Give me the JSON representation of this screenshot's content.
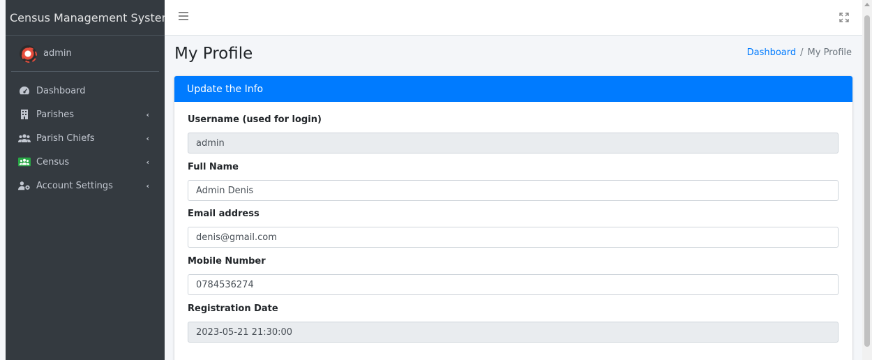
{
  "app": {
    "brand": "Census Management System"
  },
  "user": {
    "name": "admin"
  },
  "sidebar": {
    "items": [
      {
        "label": "Dashboard",
        "icon": "tachometer-icon",
        "has_arrow": false
      },
      {
        "label": "Parishes",
        "icon": "building-icon",
        "has_arrow": true
      },
      {
        "label": "Parish Chiefs",
        "icon": "users-icon",
        "has_arrow": true
      },
      {
        "label": "Census",
        "icon": "users-green-icon",
        "has_arrow": true
      },
      {
        "label": "Account Settings",
        "icon": "user-cog-icon",
        "has_arrow": true
      }
    ],
    "arrow_glyph": "‹"
  },
  "header": {
    "page_title": "My Profile",
    "breadcrumb": {
      "link": "Dashboard",
      "separator": "/",
      "current": "My Profile"
    }
  },
  "card": {
    "title": "Update the Info",
    "fields": [
      {
        "label": "Username (used for login)",
        "value": "admin",
        "readonly": true
      },
      {
        "label": "Full Name",
        "value": "Admin Denis",
        "readonly": false
      },
      {
        "label": "Email address",
        "value": "denis@gmail.com",
        "readonly": false
      },
      {
        "label": "Mobile Number",
        "value": "0784536274",
        "readonly": false
      },
      {
        "label": "Registration Date",
        "value": "2023-05-21 21:30:00",
        "readonly": true
      }
    ]
  },
  "colors": {
    "primary": "#007bff",
    "sidebar_bg": "#343a40",
    "census_icon": "#28a745"
  }
}
